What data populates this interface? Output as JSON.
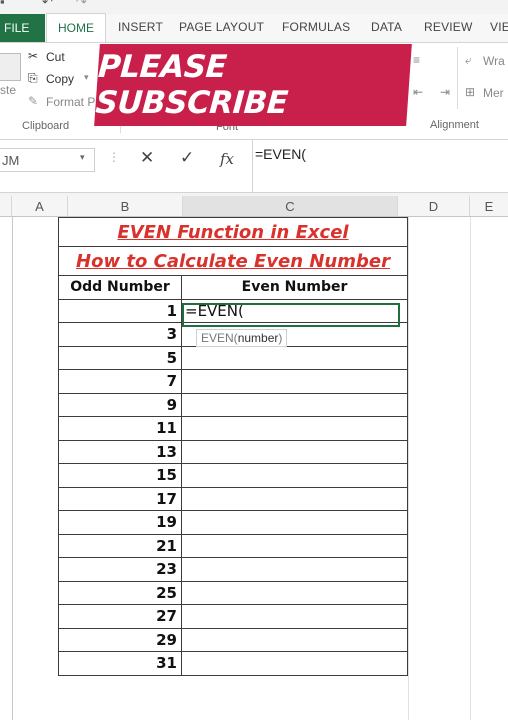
{
  "ribbon": {
    "tabs": [
      "FILE",
      "HOME",
      "INSERT",
      "PAGE LAYOUT",
      "FORMULAS",
      "DATA",
      "REVIEW",
      "VIE"
    ],
    "clipboard": {
      "cut": "Cut",
      "copy": "Copy",
      "format_painter": "Format P",
      "paste_partial": "ste",
      "label": "Clipboard"
    },
    "font_label": "Font",
    "alignment": {
      "wrap": "Wra",
      "merge": "Mer",
      "label": "Alignment"
    }
  },
  "overlay": {
    "text": "PLEASE SUBSCRIBE"
  },
  "formula_bar": {
    "name_box": "JM",
    "cancel": "✕",
    "enter": "✓",
    "fx": "fx",
    "value": "=EVEN("
  },
  "columns": [
    "A",
    "B",
    "C",
    "D",
    "E"
  ],
  "sheet": {
    "title1": "EVEN Function in Excel",
    "title2": "How to Calculate Even Number",
    "header_odd": "Odd Number",
    "header_even": "Even Number",
    "odd_numbers": [
      "1",
      "3",
      "5",
      "7",
      "9",
      "11",
      "13",
      "15",
      "17",
      "19",
      "21",
      "23",
      "25",
      "27",
      "29",
      "31"
    ],
    "active_cell_value": "=EVEN(",
    "tooltip": {
      "func": "EVEN(",
      "arg": "number",
      "close": ")"
    }
  },
  "colors": {
    "accent": "#217346",
    "title_red": "#d9312b",
    "banner": "#c8204a"
  }
}
